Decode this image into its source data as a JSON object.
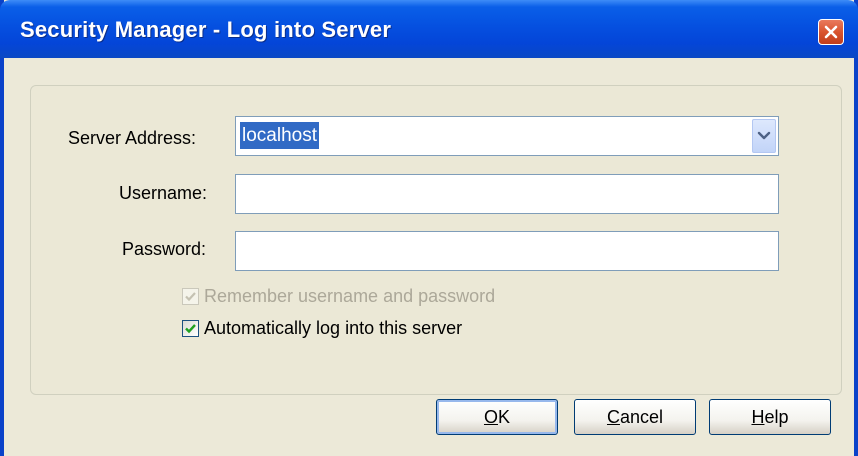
{
  "window": {
    "title": "Security Manager - Log into Server"
  },
  "form": {
    "server_address": {
      "label": "Server Address:",
      "value": "localhost"
    },
    "username": {
      "label": "Username:",
      "value": ""
    },
    "password": {
      "label": "Password:",
      "value": ""
    },
    "remember": {
      "label": "Remember username and password",
      "checked": true,
      "enabled": false
    },
    "auto_login": {
      "label": "Automatically log into this server",
      "checked": true,
      "enabled": true
    }
  },
  "buttons": {
    "ok": {
      "mnemonic": "O",
      "rest": "K"
    },
    "cancel": {
      "mnemonic": "C",
      "rest": "ancel"
    },
    "help": {
      "mnemonic": "H",
      "rest": "elp"
    }
  },
  "colors": {
    "titlebar": "#0550e0",
    "selection": "#316ac5",
    "checkmark": "#21a121",
    "dialog_bg": "#ece9d8"
  },
  "icons": {
    "close": "close-icon",
    "dropdown": "chevron-down-icon",
    "check": "checkmark-icon"
  }
}
